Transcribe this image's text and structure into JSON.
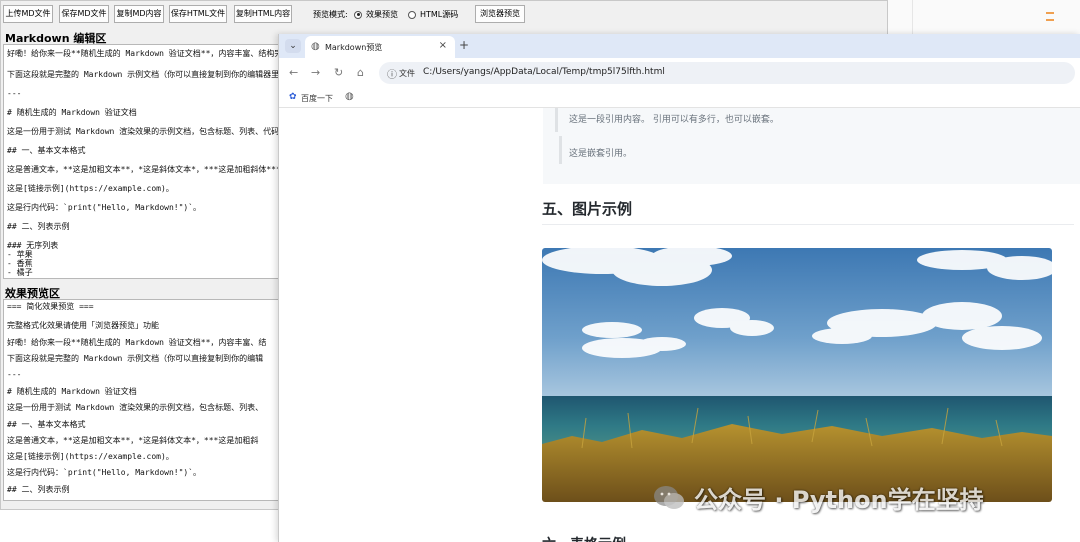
{
  "toolbar": {
    "buttons": [
      "上传MD文件",
      "保存MD文件",
      "复制MD内容",
      "保存HTML文件",
      "复制HTML内容"
    ],
    "mode_label": "预览模式:",
    "modes": [
      {
        "label": "效果预览",
        "selected": true
      },
      {
        "label": "HTML源码",
        "selected": false
      }
    ],
    "browser_preview_button": "浏览器预览"
  },
  "editor": {
    "title": "Markdown 编辑区",
    "lines": [
      "好嘞！给你来一段**随机生成的 Markdown 验证文档**，内容丰富、结构完",
      "下面这段就是完整的 Markdown 示例文档（你可以直接复制到你的编辑器里",
      "---",
      "# 随机生成的 Markdown 验证文档",
      "这是一份用于测试 Markdown 渲染效果的示例文档，包含标题、列表、代码",
      "## 一、基本文本格式",
      "这是普通文本，**这是加粗文本**，*这是斜体文本*，***这是加粗斜体***",
      "这是[链接示例](https://example.com)。",
      "这是行内代码：`print(\"Hello, Markdown!\")`。",
      "## 二、列表示例",
      "### 无序列表",
      "- 苹果",
      "- 香蕉",
      "- 橘子"
    ]
  },
  "preview": {
    "title": "效果预览区",
    "lines": [
      "=== 简化效果预览 ===",
      "完整格式化效果请使用「浏览器预览」功能",
      "好嘞！给你来一段**随机生成的 Markdown 验证文档**，内容丰富、结",
      "下面这段就是完整的 Markdown 示例文档（你可以直接复制到你的编辑",
      "---",
      "# 随机生成的 Markdown 验证文档",
      "这是一份用于测试 Markdown 渲染效果的示例文档，包含标题、列表、",
      "## 一、基本文本格式",
      "这是普通文本，**这是加粗文本**，*这是斜体文本*，***这是加粗斜",
      "这是[链接示例](https://example.com)。",
      "这是行内代码：`print(\"Hello, Markdown!\")`。",
      "## 二、列表示例"
    ]
  },
  "browser": {
    "tab_title": "Markdown预览",
    "url_label": "文件",
    "url": "C:/Users/yangs/AppData/Local/Temp/tmp5l75lfth.html",
    "bookmark": "百度一下",
    "quote_text": "这是一段引用内容。 引用可以有多行，也可以嵌套。",
    "nested_quote": "这是嵌套引用。",
    "heading": "五、图片示例",
    "next_heading": "六、表格示例"
  },
  "watermark": {
    "text": "公众号 · Python学在坚持"
  },
  "colors": {
    "app_bg": "#f0f0f0",
    "tabstrip": "#dfe8f7",
    "omnibox": "#eef1f6",
    "quote_bg": "#f6f8fa",
    "heading": "#24292e"
  }
}
